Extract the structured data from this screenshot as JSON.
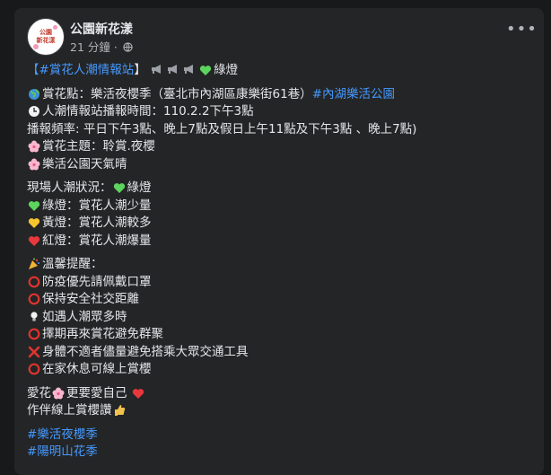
{
  "post": {
    "page_name": "公園新花漾",
    "avatar_text_1": "公園",
    "avatar_text_2": "新花漾",
    "timestamp": "21 分鐘",
    "separator": "·",
    "more_label": "•••"
  },
  "content": {
    "title_open": "【",
    "title_tag": "#賞花人潮情報站",
    "title_close": "】",
    "title_tail": "綠燈",
    "l1_pre": "賞花點：樂活夜櫻季（臺北市內湖區康樂街61巷）",
    "l1_tag": "#內湖樂活公園",
    "l2": "人潮情報站播報時間：110.2.2下午3點",
    "l3": "播報頻率: 平日下午3點、晚上7點及假日上午11點及下午3點 、晚上7點)",
    "l4": "賞花主題：聆賞.夜櫻",
    "l5": "樂活公園天氣晴",
    "l6_pre": "現場人潮狀況：",
    "l6_post": "綠燈",
    "l7": "綠燈：賞花人潮少量",
    "l8": "黃燈：賞花人潮較多",
    "l9": "紅燈：賞花人潮爆量",
    "l10": "溫馨提醒：",
    "l11": "防疫優先請佩戴口罩",
    "l12": "保持安全社交距離",
    "l13": "如遇人潮眾多時",
    "l14": "擇期再來賞花避免群聚",
    "l15": "身體不適者儘量避免搭乘大眾交通工具",
    "l16": "在家休息可線上賞櫻",
    "l17_pre": "愛花",
    "l17_mid": "更要愛自己",
    "l18": "作伴線上賞櫻讚",
    "tag1": "#樂活夜櫻季",
    "tag2": "#陽明山花季"
  },
  "colors": {
    "background": "#18191a",
    "card": "#242526",
    "text": "#e4e6eb",
    "secondary": "#b0b3b8",
    "hashtag": "#4599ff",
    "green_heart": "#5dd45d",
    "yellow_heart": "#f7c52e",
    "red_heart": "#e8383d",
    "red_circle": "#e0342f"
  },
  "icons": [
    "globe-icon",
    "megaphone-icon",
    "green-heart-icon",
    "earth-icon",
    "clock-icon",
    "cherry-blossom-icon",
    "yellow-heart-icon",
    "red-heart-icon",
    "party-popper-icon",
    "red-circle-icon",
    "light-bulb-icon",
    "cross-mark-icon",
    "thumbs-up-icon",
    "more-options-icon"
  ]
}
